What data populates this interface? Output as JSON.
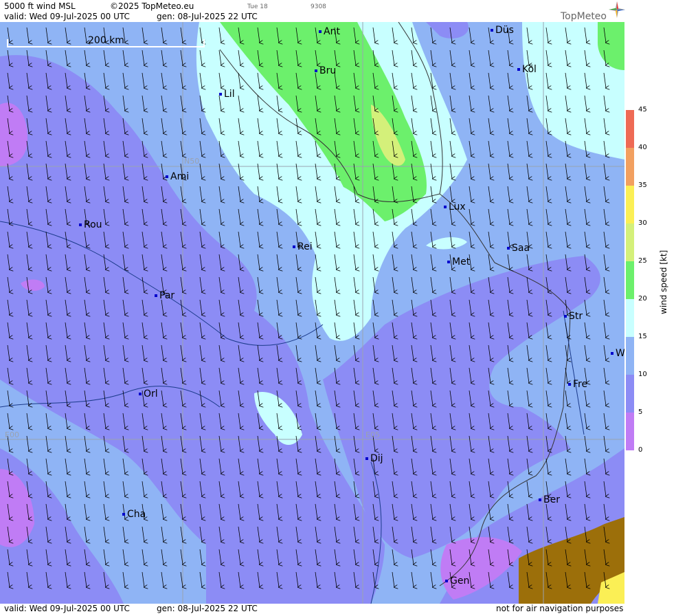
{
  "header": {
    "title": "5000 ft wind MSL",
    "copyright": "©2025 TopMeteo.eu",
    "tue": "Tue 18",
    "code": "9308",
    "valid": "valid:  Wed  09-Jul-2025  00 UTC",
    "gen": "gen: 08-Jul-2025 22 UTC"
  },
  "logo": {
    "text": "TopMeteo",
    "icon": "compass-star-icon"
  },
  "map": {
    "scale_label": "200 km",
    "grid_labels": {
      "n50": "N50",
      "e00": "E00",
      "e05": "E05"
    },
    "cities": [
      {
        "name": "Ant"
      },
      {
        "name": "Düs"
      },
      {
        "name": "Bru"
      },
      {
        "name": "Köl"
      },
      {
        "name": "Lil"
      },
      {
        "name": "Ami"
      },
      {
        "name": "Lux"
      },
      {
        "name": "Rou"
      },
      {
        "name": "Rei"
      },
      {
        "name": "Saa"
      },
      {
        "name": "Met"
      },
      {
        "name": "Par"
      },
      {
        "name": "Str"
      },
      {
        "name": "W"
      },
      {
        "name": "Fre"
      },
      {
        "name": "Orl"
      },
      {
        "name": "Dij"
      },
      {
        "name": "Ber"
      },
      {
        "name": "Cha"
      },
      {
        "name": "Gen"
      }
    ],
    "wind_direction": "north to south"
  },
  "legend": {
    "title": "wind speed [kt]",
    "ticks": [
      "45",
      "40",
      "35",
      "30",
      "25",
      "20",
      "15",
      "10",
      "5",
      "0"
    ],
    "colors": [
      "#ee6a55",
      "#f2a060",
      "#fbef55",
      "#d4f07a",
      "#6cf06c",
      "#c8ffff",
      "#8fb4f5",
      "#8c8cf5",
      "#c07cf5"
    ]
  },
  "footer": {
    "valid": "valid:  Wed  09-Jul-2025  00 UTC",
    "gen": "gen: 08-Jul-2025 22 UTC",
    "disclaimer": "not for air navigation purposes"
  }
}
